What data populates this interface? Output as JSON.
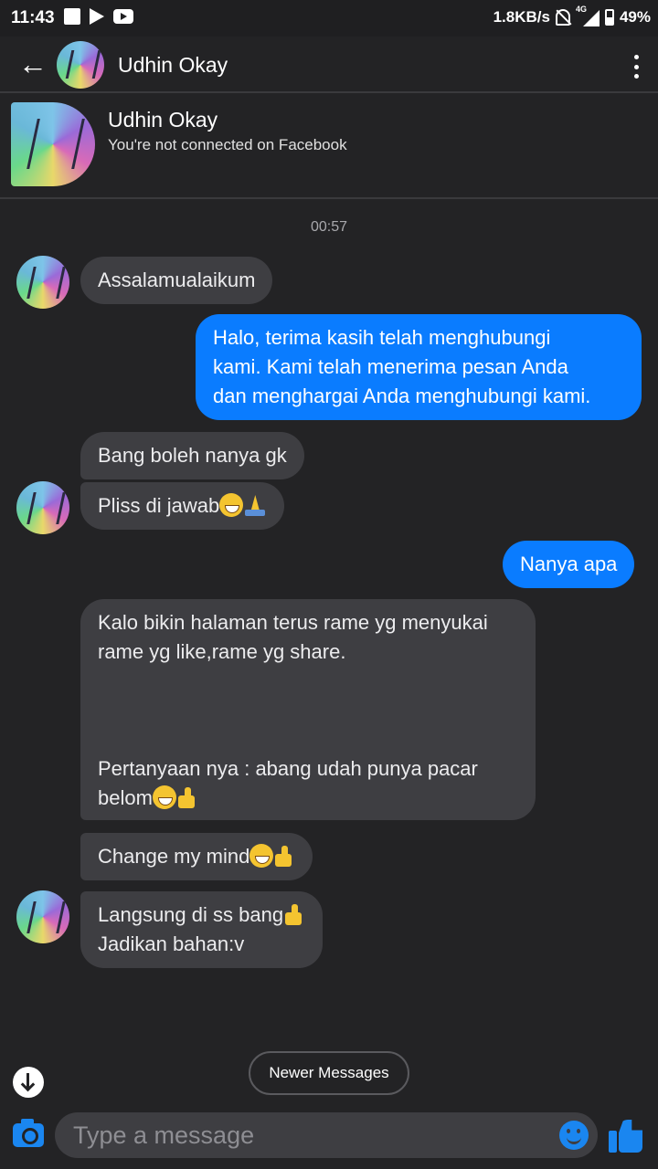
{
  "status_bar": {
    "time": "11:43",
    "net_speed": "1.8KB/s",
    "network_type": "4G",
    "battery": "49%"
  },
  "header": {
    "title": "Udhin Okay",
    "icons": [
      "back-arrow-icon",
      "avatar",
      "more-vert-icon"
    ]
  },
  "profile": {
    "name": "Udhin Okay",
    "subtitle": "You're not connected on Facebook"
  },
  "timestamp": "00:57",
  "messages": [
    {
      "from": "them",
      "lines": [
        "Assalamualaikum"
      ]
    },
    {
      "from": "me",
      "lines": [
        "Halo, terima kasih telah menghubungi",
        "kami. Kami telah menerima pesan Anda",
        "dan menghargai Anda menghubungi kami."
      ]
    },
    {
      "from": "them",
      "lines": [
        "Bang boleh nanya gk"
      ]
    },
    {
      "from": "them",
      "lines": [
        "Pliss di jawab"
      ],
      "emojis": [
        "grinning-sweat",
        "folded-hands"
      ]
    },
    {
      "from": "me",
      "lines": [
        "Nanya apa"
      ]
    },
    {
      "from": "them",
      "lines": [
        "Kalo bikin halaman terus rame yg menyukai",
        "rame yg like,rame yg share.",
        "",
        "",
        "",
        "Pertanyaan nya : abang udah punya pacar",
        "belom"
      ],
      "emojis": [
        "grinning-sweat",
        "thumbs-up"
      ]
    },
    {
      "from": "them",
      "lines": [
        "Change my mind"
      ],
      "emojis": [
        "grinning-sweat",
        "thumbs-up"
      ]
    },
    {
      "from": "them",
      "lines": [
        "Langsung di ss bang",
        "Jadikan bahan:v"
      ],
      "emojis": [
        "thumbs-up"
      ]
    }
  ],
  "newer_messages_label": "Newer Messages",
  "composer": {
    "placeholder": "Type a message",
    "value": ""
  },
  "colors": {
    "background": "#232325",
    "incoming_bubble": "#3e3e42",
    "outgoing_bubble": "#0a7cff",
    "accent": "#1a86f0"
  }
}
